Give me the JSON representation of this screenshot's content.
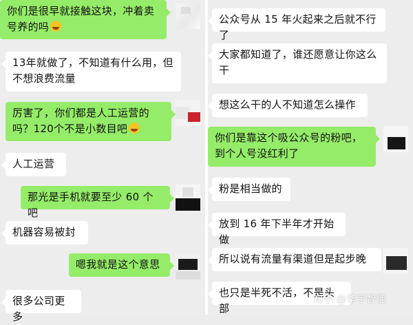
{
  "left_chat": {
    "messages": [
      {
        "side": "green",
        "text": "你们是很早就接触这块，冲着卖号养的吗",
        "emoji": "laughing-emoji"
      },
      {
        "side": "white",
        "text": "13年就做了，不知道有什么用，但不想浪费流量"
      },
      {
        "side": "green",
        "text": "厉害了，你们都是人工运营的吗？120个不是小数目吧",
        "emoji": "sweat-smile-emoji"
      },
      {
        "side": "white",
        "text": "人工运营"
      },
      {
        "side": "green",
        "text": "那光是手机就要至少 60 个吧"
      },
      {
        "side": "white",
        "text": "机器容易被封"
      },
      {
        "side": "green",
        "text": "嗯我就是这个意思"
      },
      {
        "side": "white",
        "text": "很多公司更多"
      }
    ]
  },
  "right_chat": {
    "messages": [
      {
        "side": "white",
        "text": "公众号从 15 年火起来之后就不行了"
      },
      {
        "side": "white",
        "text": "大家都知道了，谁还愿意让你这么干"
      },
      {
        "side": "white",
        "text": "想这么干的人不知道怎么操作"
      },
      {
        "side": "green",
        "text": "你们是靠这个吸公众号的粉吧，到个人号没红利了"
      },
      {
        "side": "white",
        "text": "粉是相当做的"
      },
      {
        "side": "white",
        "text": "放到 16 年下半年才开始做"
      },
      {
        "side": "white",
        "text": "所以说有流量有渠道但是起步晚"
      },
      {
        "side": "white",
        "text": "也只是半死不活，不是头部"
      }
    ]
  },
  "watermark": "知乎 @华宇智能"
}
